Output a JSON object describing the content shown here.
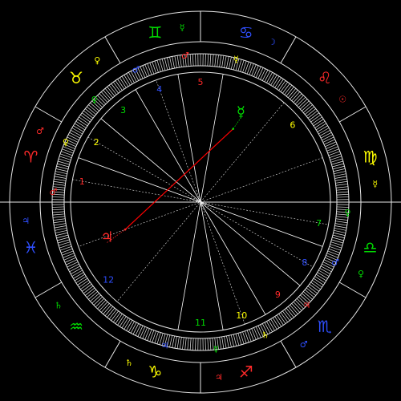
{
  "colors": {
    "background": "#000000",
    "lines": "#e6e6e6",
    "fire": "#ff2a2a",
    "earth": "#ffff00",
    "air": "#00dd00",
    "water": "#2f4fff",
    "aspect_red": "#ff0000",
    "aspect_green": "#00ee00",
    "house_cusp": "#ffffff"
  },
  "signs": [
    {
      "name": "Aries",
      "glyph": "♈",
      "color": "#ff2a2a"
    },
    {
      "name": "Taurus",
      "glyph": "♉",
      "color": "#ffff00"
    },
    {
      "name": "Gemini",
      "glyph": "♊",
      "color": "#00dd00"
    },
    {
      "name": "Cancer",
      "glyph": "♋",
      "color": "#2f4fff"
    },
    {
      "name": "Leo",
      "glyph": "♌",
      "color": "#ff2a2a"
    },
    {
      "name": "Virgo",
      "glyph": "♍",
      "color": "#ffff00"
    },
    {
      "name": "Libra",
      "glyph": "♎",
      "color": "#00dd00"
    },
    {
      "name": "Scorpio",
      "glyph": "♏",
      "color": "#2f4fff"
    },
    {
      "name": "Sagittarius",
      "glyph": "♐",
      "color": "#ff2a2a"
    },
    {
      "name": "Capricorn",
      "glyph": "♑",
      "color": "#ffff00"
    },
    {
      "name": "Aquarius",
      "glyph": "♒",
      "color": "#00dd00"
    },
    {
      "name": "Pisces",
      "glyph": "♓",
      "color": "#2f4fff"
    }
  ],
  "sign_rulers": [
    {
      "sign": "Aries",
      "glyph": "♂",
      "color": "#ff2a2a"
    },
    {
      "sign": "Taurus",
      "glyph": "♀",
      "color": "#ffff00"
    },
    {
      "sign": "Gemini",
      "glyph": "☿",
      "color": "#00dd00"
    },
    {
      "sign": "Cancer",
      "glyph": "☽",
      "color": "#2f4fff"
    },
    {
      "sign": "Leo",
      "glyph": "☉",
      "color": "#ff2a2a"
    },
    {
      "sign": "Virgo",
      "glyph": "☿",
      "color": "#ffff00"
    },
    {
      "sign": "Libra",
      "glyph": "♀",
      "color": "#00dd00"
    },
    {
      "sign": "Scorpio",
      "glyph": "♂",
      "color": "#2f4fff"
    },
    {
      "sign": "Sagittarius",
      "glyph": "♃",
      "color": "#ff2a2a"
    },
    {
      "sign": "Capricorn",
      "glyph": "♄",
      "color": "#ffff00"
    },
    {
      "sign": "Aquarius",
      "glyph": "♄",
      "color": "#00dd00"
    },
    {
      "sign": "Pisces",
      "glyph": "♃",
      "color": "#2f4fff"
    }
  ],
  "ascendant_longitude": 0,
  "house_cusp_longitudes": [
    0,
    20,
    40,
    60,
    80,
    100,
    180,
    200,
    220,
    240,
    260,
    280
  ],
  "houses": [
    {
      "number": "1",
      "color": "#ff2a2a",
      "planet": {
        "glyph": "♂",
        "color": "#ff2a2a"
      }
    },
    {
      "number": "2",
      "color": "#ffff00",
      "planet": {
        "glyph": "♀",
        "color": "#ffff00"
      }
    },
    {
      "number": "3",
      "color": "#00dd00",
      "planet": {
        "glyph": "♀",
        "color": "#00dd00"
      }
    },
    {
      "number": "4",
      "color": "#2f4fff",
      "planet": {
        "glyph": "♂",
        "color": "#2f4fff"
      }
    },
    {
      "number": "5",
      "color": "#ff2a2a",
      "planet": {
        "glyph": "♂",
        "color": "#ff2a2a"
      }
    },
    {
      "number": "6",
      "color": "#ffff00",
      "planet": {
        "glyph": "☿",
        "color": "#ffff00"
      }
    },
    {
      "number": "7",
      "color": "#00dd00",
      "planet": {
        "glyph": "♀",
        "color": "#00dd00"
      }
    },
    {
      "number": "8",
      "color": "#2f4fff",
      "planet": {
        "glyph": "♂",
        "color": "#2f4fff"
      }
    },
    {
      "number": "9",
      "color": "#ff2a2a",
      "planet": {
        "glyph": "♃",
        "color": "#ff2a2a"
      }
    },
    {
      "number": "10",
      "color": "#ffff00",
      "planet": {
        "glyph": "♄",
        "color": "#ffff00"
      }
    },
    {
      "number": "11",
      "color": "#00dd00",
      "planet": {
        "glyph": "☿",
        "color": "#00dd00"
      }
    },
    {
      "number": "12",
      "color": "#2f4fff",
      "planet": {
        "glyph": "♃",
        "color": "#2f4fff"
      }
    }
  ],
  "chart_points": [
    {
      "name": "Jupiter",
      "glyph": "♃",
      "color": "#ff2a2a",
      "longitude": 340
    },
    {
      "name": "Mercury",
      "glyph": "☿",
      "color": "#00dd00",
      "longitude": 114
    }
  ],
  "aspects": [
    {
      "from": "Jupiter",
      "to": "Mercury",
      "color": "#ff0000"
    }
  ],
  "diagonal_lines": [
    {
      "longitude_a": 10,
      "longitude_b": 190
    },
    {
      "longitude_a": 30,
      "longitude_b": 210
    },
    {
      "longitude_a": 250,
      "longitude_b": 70
    },
    {
      "longitude_a": 130,
      "longitude_b": 310
    },
    {
      "longitude_a": 160,
      "longitude_b": 340
    }
  ]
}
